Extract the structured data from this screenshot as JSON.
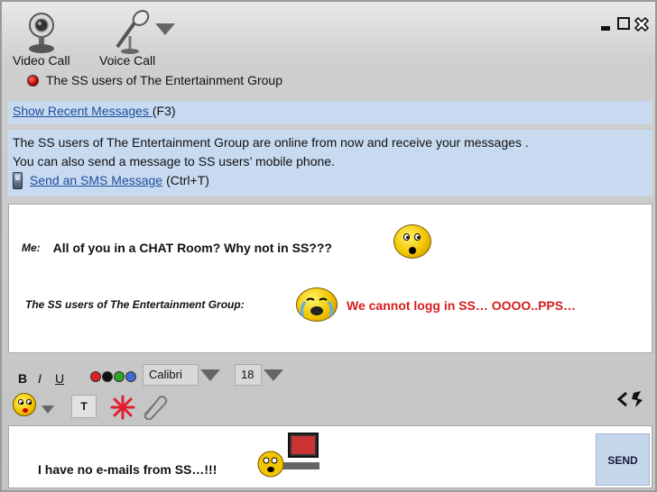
{
  "toolbar": {
    "video_call_label": "Video Call",
    "voice_call_label": "Voice Call",
    "contact_name": "The SS users of The Entertainment Group"
  },
  "recent": {
    "link_text": "Show Recent Messages ",
    "shortcut": "(F3)"
  },
  "info": {
    "line1": "The SS users of The Entertainment Group are online from now and receive your messages .",
    "line2": "You can also send a message to SS users’ mobile phone.",
    "sms_link_text": "Send an SMS Message ",
    "sms_shortcut": "(Ctrl+T)"
  },
  "chat": {
    "messages": [
      {
        "sender": "Me:",
        "text": "All of you in a CHAT Room? Why not in SS???",
        "emoticon": "shocked-face-icon"
      },
      {
        "sender": "The SS users of The Entertainment Group:",
        "text": "We cannot logg in SS… OOOO..PPS…",
        "emoticon": "crying-face-icon",
        "text_color": "#d81d1d"
      }
    ]
  },
  "format": {
    "bold": "B",
    "italic": "I",
    "underline": "U",
    "colors": [
      "#e02020",
      "#111111",
      "#2aa52a",
      "#3b6fd6"
    ],
    "font_family": "Calibri",
    "font_size": "18",
    "text_button": "T"
  },
  "compose": {
    "text": "I have no e-mails from SS…!!!",
    "send_label": "SEND"
  },
  "colors": {
    "panel_blue": "#c8daf0",
    "link": "#1d4f9c",
    "alert_red": "#d81d1d"
  }
}
